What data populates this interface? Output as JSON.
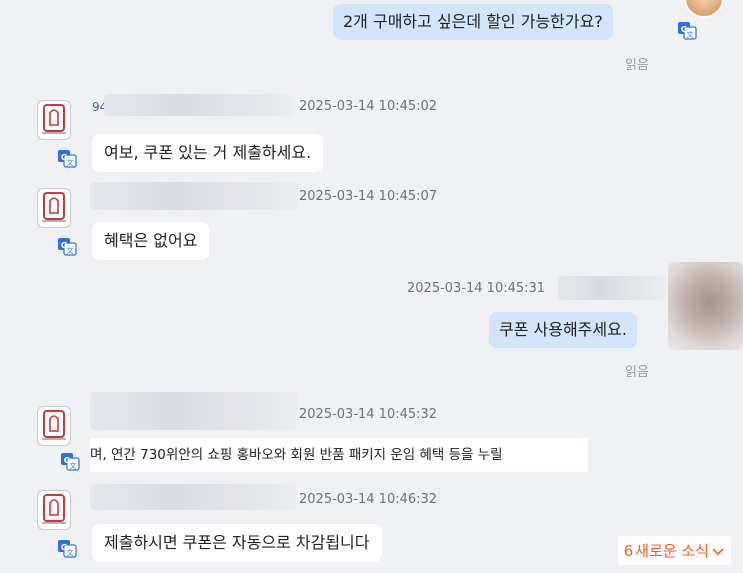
{
  "messages": [
    {
      "dir": "out",
      "text": "2개 구매하고 싶은데 할인 가능한가요?",
      "read": "읽음"
    },
    {
      "dir": "in",
      "sender_prefix": "94",
      "timestamp": "2025-03-14 10:45:02",
      "text": "여보, 쿠폰 있는 거 제출하세요."
    },
    {
      "dir": "in",
      "timestamp": "2025-03-14 10:45:07",
      "text": "혜택은 없어요"
    },
    {
      "dir": "out",
      "timestamp": "2025-03-14 10:45:31",
      "text": "쿠폰 사용해주세요.",
      "read": "읽음"
    },
    {
      "dir": "in",
      "timestamp": "2025-03-14 10:45:32",
      "text": "며, 연간 730위안의 쇼핑 홍바오와 회원 반품 패키지 운임 혜택 등을 누릴"
    },
    {
      "dir": "in",
      "timestamp": "2025-03-14 10:46:32",
      "text": "제출하시면 쿠폰은 자동으로 차감됩니다"
    }
  ],
  "news_badge": {
    "count": "6",
    "label": "새로운 소식",
    "color": "#ff5a1f"
  },
  "colors": {
    "outgoing_bubble": "#d3e5fb",
    "incoming_bubble": "#ffffff",
    "translate_icon": "#2f6fe0",
    "background": "#f0f1f5"
  },
  "icons": {
    "translate": "translate-icon",
    "chevron": "chevron-down-icon",
    "seller_avatar": "seller-avatar"
  }
}
